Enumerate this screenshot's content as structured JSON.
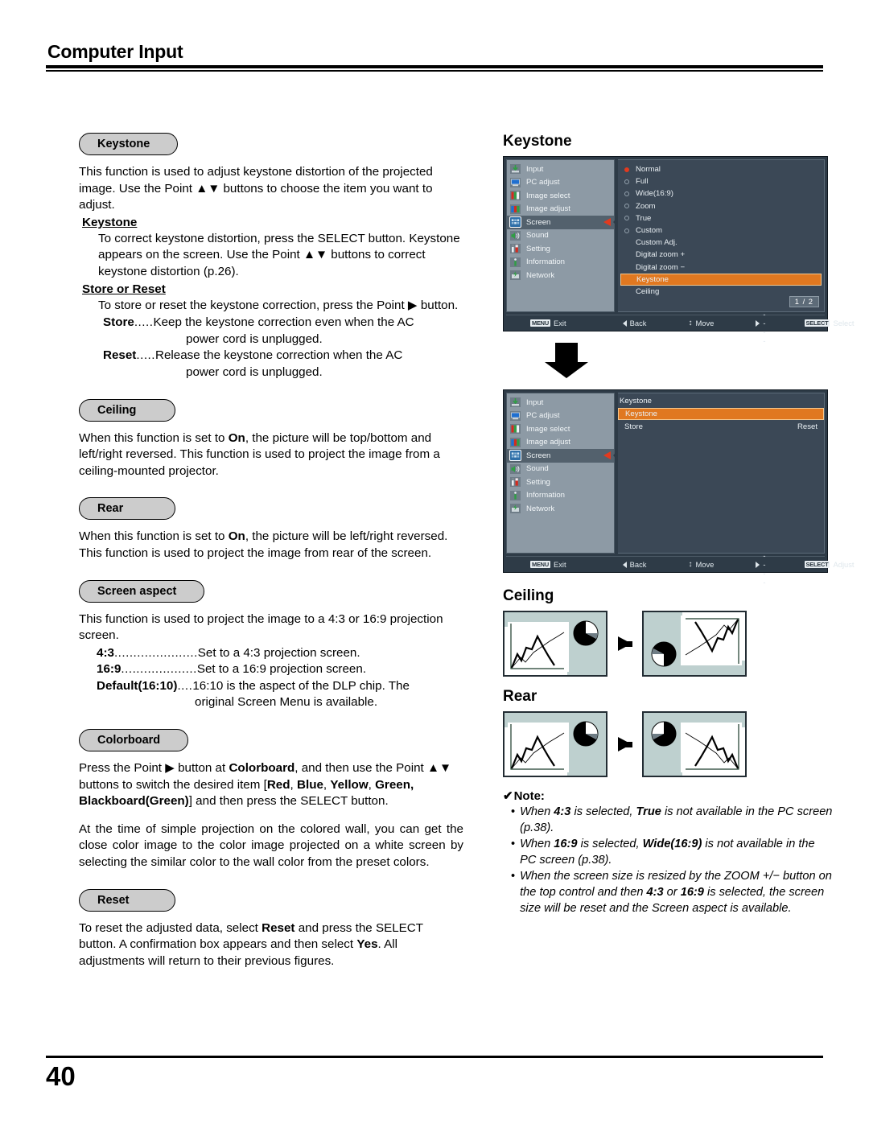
{
  "header": {
    "title": "Computer Input"
  },
  "footer": {
    "page_number": "40"
  },
  "left": {
    "keystone": {
      "pill": "Keystone",
      "intro": "This function is used to adjust keystone distortion of the projected image. Use the Point ▲▼ buttons to choose the item you want to adjust.",
      "sub1_head": "Keystone",
      "sub1_body": "To correct keystone distortion, press the SELECT button. Keystone appears on the screen. Use the Point ▲▼ buttons to correct keystone distortion (p.26).",
      "sub2_head": "Store or Reset",
      "sub2_body": "To store or reset the keystone correction, press the Point ▶ button.",
      "defs": [
        {
          "term": "Store",
          "dots": ".....",
          "line1": "Keep the keystone correction even when the AC",
          "line2": "power cord is unplugged."
        },
        {
          "term": "Reset",
          "dots": ".....",
          "line1": "Release the keystone correction when the AC",
          "line2": "power cord is unplugged."
        }
      ]
    },
    "ceiling": {
      "pill": "Ceiling",
      "body_pre": "When this function is set to ",
      "body_bold": "On",
      "body_post": ", the picture will be top/bottom and left/right reversed. This function is used to project the image from a ceiling-mounted projector."
    },
    "rear": {
      "pill": "Rear",
      "body_pre": "When this function is set to ",
      "body_bold": "On",
      "body_post": ", the picture will be left/right reversed. This function is used to project the image from rear of the screen."
    },
    "screen_aspect": {
      "pill": "Screen aspect",
      "intro": "This function is used to project the image to a 4:3 or 16:9 projection screen.",
      "defs": [
        {
          "term": "4:3",
          "dots": "......................",
          "line1": "Set to a 4:3 projection screen.",
          "line2": ""
        },
        {
          "term": "16:9",
          "dots": "....................",
          "line1": "Set to a 16:9 projection screen.",
          "line2": ""
        },
        {
          "term": "Default(16:10)",
          "dots": "....",
          "line1": "16:10 is the aspect of the DLP chip. The",
          "line2": "original Screen Menu is available."
        }
      ]
    },
    "colorboard": {
      "pill": "Colorboard",
      "p1_a": "Press the Point ▶ button at ",
      "p1_b": "Colorboard",
      "p1_c": ", and then use the Point ▲▼ buttons to switch the desired item [",
      "p1_d": "Red",
      "p1_e": ", ",
      "p1_f": "Blue",
      "p1_g": ", ",
      "p1_h": "Yellow",
      "p1_i": ", ",
      "p1_j": "Green, Blackboard(Green)",
      "p1_k": "] and then press the SELECT button.",
      "p2": "At the time of simple projection on the colored wall, you can get the close color image to the color image projected on a white screen by selecting the similar color to the wall color from the preset colors."
    },
    "reset": {
      "pill": "Reset",
      "p1_a": "To reset the adjusted data, select ",
      "p1_b": "Reset",
      "p1_c": " and press the SELECT button. A confirmation box appears and then select ",
      "p1_d": "Yes",
      "p1_e": ". All adjustments will return to their previous figures."
    }
  },
  "right": {
    "keystone_heading": "Keystone",
    "ceiling_heading": "Ceiling",
    "rear_heading": "Rear",
    "osd_sidebar": [
      {
        "label": "Input",
        "icon": "input-icon",
        "selected": false
      },
      {
        "label": "PC adjust",
        "icon": "pc-adjust-icon",
        "selected": false
      },
      {
        "label": "Image select",
        "icon": "image-select-icon",
        "selected": false
      },
      {
        "label": "Image adjust",
        "icon": "image-adjust-icon",
        "selected": false
      },
      {
        "label": "Screen",
        "icon": "screen-icon",
        "selected": true
      },
      {
        "label": "Sound",
        "icon": "sound-icon",
        "selected": false
      },
      {
        "label": "Setting",
        "icon": "setting-icon",
        "selected": false
      },
      {
        "label": "Information",
        "icon": "information-icon",
        "selected": false
      },
      {
        "label": "Network",
        "icon": "network-icon",
        "selected": false
      }
    ],
    "osd1": {
      "options": [
        {
          "label": "Normal",
          "radio": "on"
        },
        {
          "label": "Full",
          "radio": "off"
        },
        {
          "label": "Wide(16:9)",
          "radio": "off"
        },
        {
          "label": "Zoom",
          "radio": "off"
        },
        {
          "label": "True",
          "radio": "off"
        },
        {
          "label": "Custom",
          "radio": "off"
        },
        {
          "label": "Custom Adj.",
          "radio": "none"
        },
        {
          "label": "Digital zoom +",
          "radio": "none"
        },
        {
          "label": "Digital zoom −",
          "radio": "none"
        },
        {
          "label": "Keystone",
          "radio": "none",
          "highlight": true
        },
        {
          "label": "Ceiling",
          "radio": "none"
        }
      ],
      "page_indicator": "1 / 2",
      "bar": {
        "exit_key": "MENU",
        "exit_label": "Exit",
        "back_label": "Back",
        "move_label": "Move",
        "dash_label": "-----",
        "select_key": "SELECT",
        "select_label": "Select"
      }
    },
    "osd2": {
      "panel_title": "Keystone",
      "rows": [
        {
          "label": "Keystone",
          "value": "",
          "highlight": true
        },
        {
          "label": "Store",
          "value": "Reset",
          "highlight": false
        }
      ],
      "bar": {
        "exit_key": "MENU",
        "exit_label": "Exit",
        "back_label": "Back",
        "move_label": "Move",
        "dash_label": "-----",
        "select_key": "SELECT",
        "select_label": "Adjust"
      }
    },
    "note": {
      "title": "Note:",
      "check": "✔",
      "items": [
        {
          "a": "When ",
          "b": "4:3",
          "c": " is selected, ",
          "d": "True",
          "e": " is not available in the PC screen (p.38)."
        },
        {
          "a": "When ",
          "b": "16:9",
          "c": " is selected, ",
          "d": "Wide(16:9)",
          "e": " is not available in the PC screen (p.38)."
        },
        {
          "a": "When the screen size is resized by the ZOOM +/− button on the top control and then ",
          "b": "4:3",
          "c": " or ",
          "d": "16:9",
          "e": " is selected, the screen size will be reset and the Screen aspect is available."
        }
      ]
    }
  }
}
